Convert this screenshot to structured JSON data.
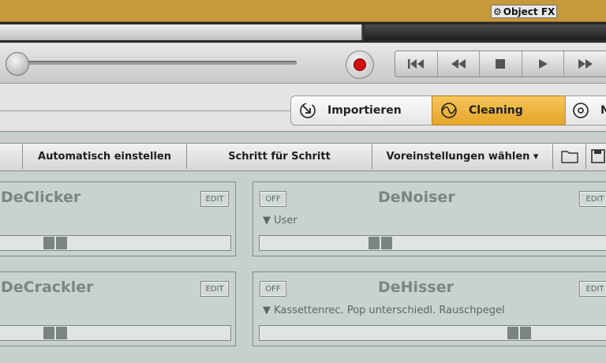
{
  "header": {
    "object_fx_label": "Object FX"
  },
  "tabs": [
    {
      "label": "Importieren",
      "icon": "import-arrow-icon"
    },
    {
      "label": "Cleaning",
      "icon": "cleaning-wave-icon",
      "active": true
    },
    {
      "label": "N",
      "icon": "target-icon"
    }
  ],
  "toolbar": {
    "auto_label": "Automatisch einstellen",
    "step_label": "Schritt für Schritt",
    "preset_label": "Voreinstellungen wählen ▾"
  },
  "panels": {
    "declicker": {
      "title": "DeClicker",
      "edit": "EDIT",
      "value": 0.21
    },
    "denoiser": {
      "title": "DeNoiser",
      "off": "OFF",
      "edit": "EDIT",
      "preset": "▼  User",
      "value": 0.33
    },
    "decrackler": {
      "title": "DeCrackler",
      "edit": "EDIT",
      "value": 0.21
    },
    "dehisser": {
      "title": "DeHisser",
      "off": "OFF",
      "edit": "EDIT",
      "preset": "▼  Kassettenrec. Pop unterschiedl. Rauschpegel",
      "value": 0.75
    }
  },
  "colors": {
    "topbar": "#c59a3a",
    "active_tab": "#f0b847",
    "record": "#d10f0f"
  }
}
